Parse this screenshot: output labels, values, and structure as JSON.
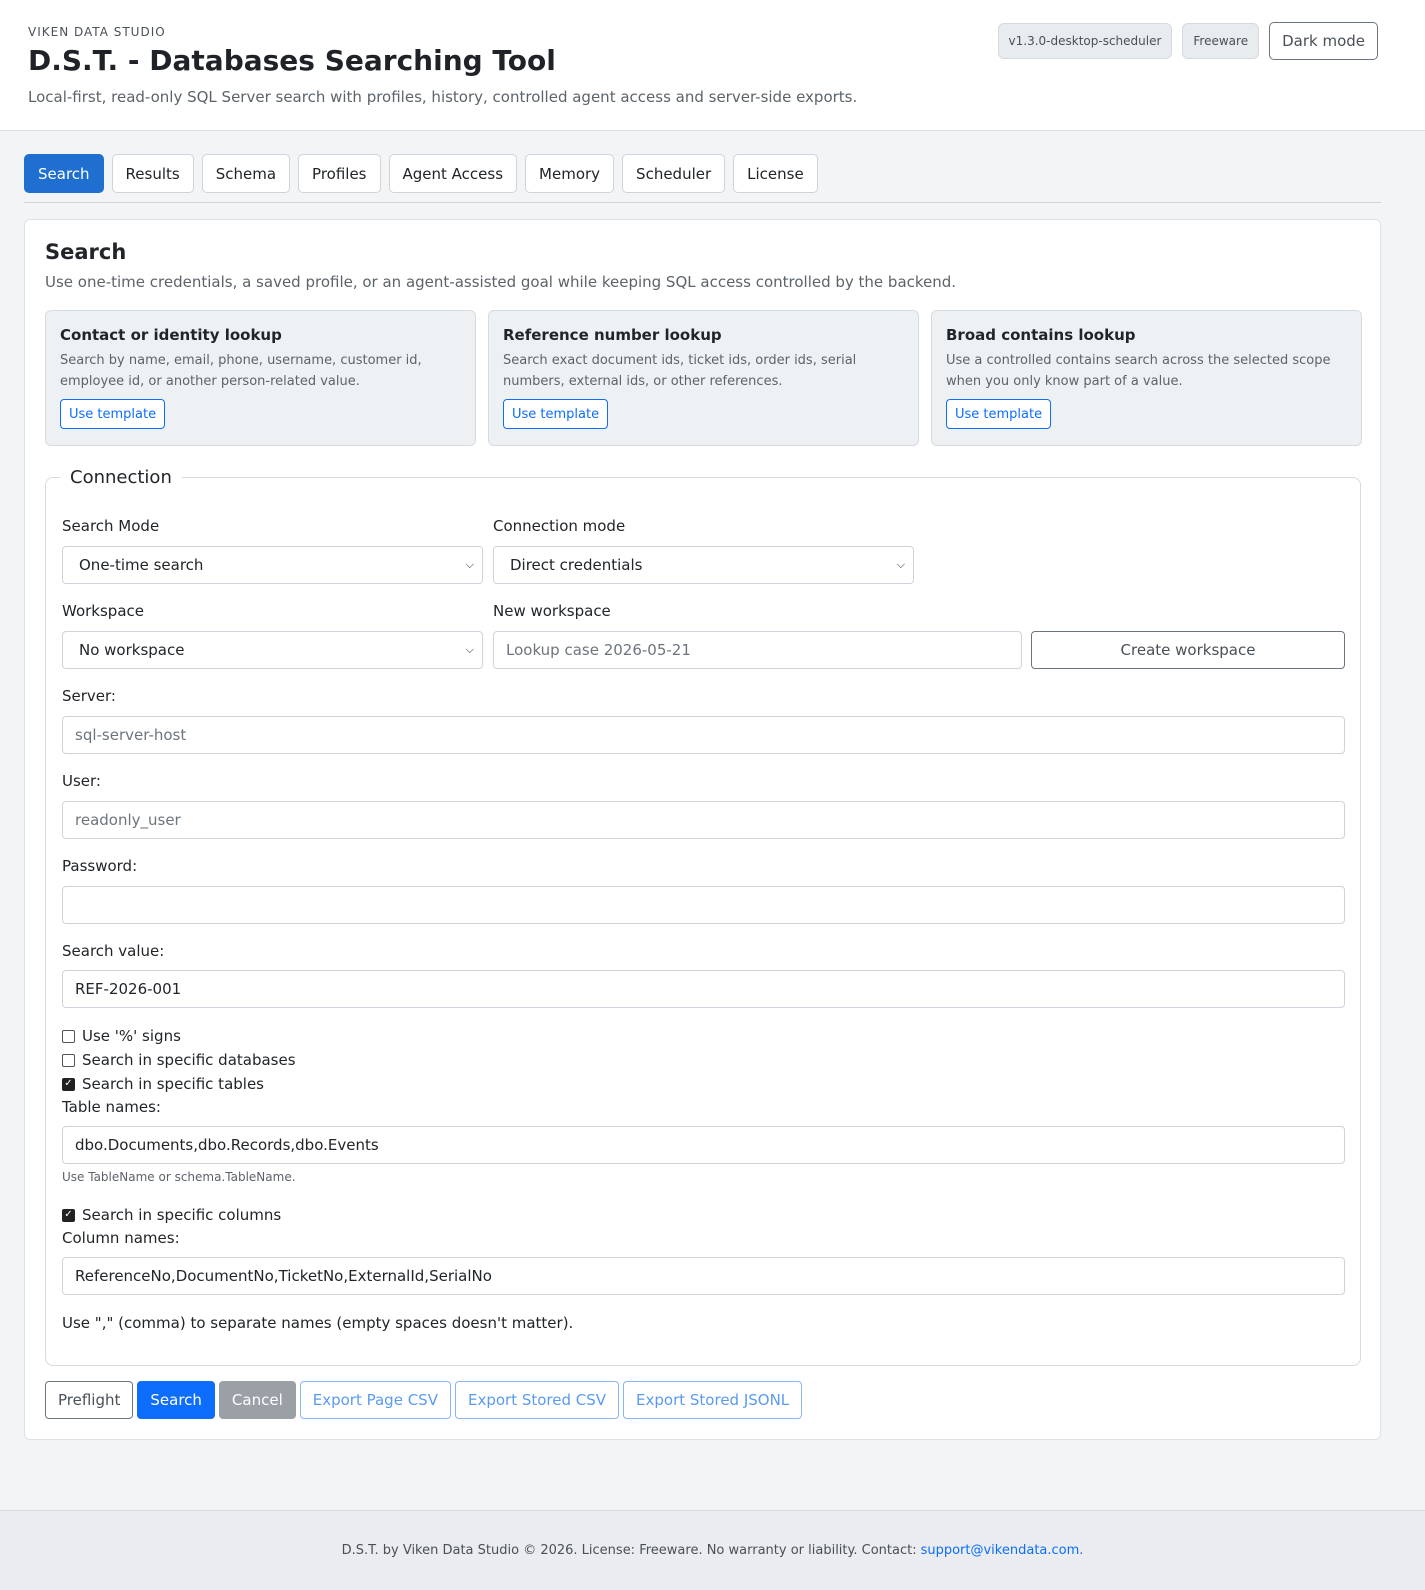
{
  "header": {
    "brand": "VIKEN DATA STUDIO",
    "title": "D.S.T. - Databases Searching Tool",
    "tagline": "Local-first, read-only SQL Server search with profiles, history, controlled agent access and server-side exports.",
    "version_badge": "v1.3.0-desktop-scheduler",
    "license_badge": "Freeware",
    "dark_mode_label": "Dark mode"
  },
  "tabs": [
    {
      "label": "Search",
      "active": true
    },
    {
      "label": "Results"
    },
    {
      "label": "Schema"
    },
    {
      "label": "Profiles"
    },
    {
      "label": "Agent Access"
    },
    {
      "label": "Memory"
    },
    {
      "label": "Scheduler"
    },
    {
      "label": "License"
    }
  ],
  "search_panel": {
    "title": "Search",
    "description": "Use one-time credentials, a saved profile, or an agent-assisted goal while keeping SQL access controlled by the backend.",
    "templates": [
      {
        "title": "Contact or identity lookup",
        "description": "Search by name, email, phone, username, customer id, employee id, or another person-related value.",
        "button": "Use template"
      },
      {
        "title": "Reference number lookup",
        "description": "Search exact document ids, ticket ids, order ids, serial numbers, external ids, or other references.",
        "button": "Use template"
      },
      {
        "title": "Broad contains lookup",
        "description": "Use a controlled contains search across the selected scope when you only know part of a value.",
        "button": "Use template"
      }
    ]
  },
  "connection": {
    "legend": "Connection",
    "search_mode": {
      "label": "Search Mode",
      "value": "One-time search"
    },
    "connection_mode": {
      "label": "Connection mode",
      "value": "Direct credentials"
    },
    "workspace": {
      "label": "Workspace",
      "value": "No workspace"
    },
    "new_workspace": {
      "label": "New workspace",
      "placeholder": "Lookup case 2026-05-21",
      "button": "Create workspace"
    },
    "server": {
      "label": "Server:",
      "placeholder": "sql-server-host"
    },
    "user": {
      "label": "User:",
      "placeholder": "readonly_user"
    },
    "password": {
      "label": "Password:",
      "value": ""
    },
    "search_value": {
      "label": "Search value:",
      "value": "REF-2026-001"
    },
    "use_percent": {
      "label": "Use '%' signs",
      "checked": false
    },
    "specific_databases": {
      "label": "Search in specific databases",
      "checked": false
    },
    "specific_tables": {
      "label": "Search in specific tables",
      "checked": true
    },
    "table_names": {
      "label": "Table names:",
      "value": "dbo.Documents,dbo.Records,dbo.Events",
      "hint": "Use TableName or schema.TableName."
    },
    "specific_columns": {
      "label": "Search in specific columns",
      "checked": true
    },
    "column_names": {
      "label": "Column names:",
      "value": "ReferenceNo,DocumentNo,TicketNo,ExternalId,SerialNo"
    },
    "separator_note": "Use \",\" (comma) to separate names (empty spaces doesn't matter)."
  },
  "actions": {
    "preflight": "Preflight",
    "search": "Search",
    "cancel": "Cancel",
    "export_page_csv": "Export Page CSV",
    "export_stored_csv": "Export Stored CSV",
    "export_stored_jsonl": "Export Stored JSONL"
  },
  "footer": {
    "text": "D.S.T. by Viken Data Studio © 2026. License: Freeware. No warranty or liability. Contact:",
    "email": "support@vikendata.com."
  },
  "colors": {
    "primary": "#0d6efd",
    "active_tab": "#1e6fd0",
    "page_bg": "#f3f4f6"
  }
}
